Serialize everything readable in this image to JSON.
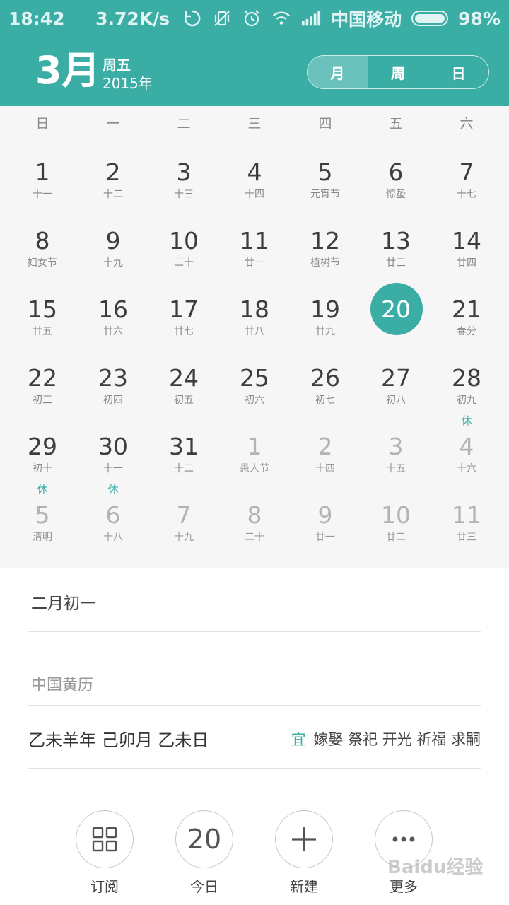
{
  "status_bar": {
    "time": "18:42",
    "speed": "3.72K/s",
    "carrier": "中国移动",
    "battery": "98%",
    "icons": [
      "sync-icon",
      "mute-icon",
      "alarm-icon",
      "wifi-icon",
      "signal-icon",
      "battery-icon"
    ]
  },
  "header": {
    "month": "3月",
    "weekday": "周五",
    "year": "2015年",
    "view_tabs": [
      "月",
      "周",
      "日"
    ],
    "active_tab": "月",
    "accent_color": "#3aada5"
  },
  "calendar": {
    "weekdays": [
      "日",
      "一",
      "二",
      "三",
      "四",
      "五",
      "六"
    ],
    "selected_day": "20",
    "weeks": [
      [
        {
          "day": "1",
          "lunar": "十一",
          "rest": ""
        },
        {
          "day": "2",
          "lunar": "十二",
          "rest": ""
        },
        {
          "day": "3",
          "lunar": "十三",
          "rest": ""
        },
        {
          "day": "4",
          "lunar": "十四",
          "rest": ""
        },
        {
          "day": "5",
          "lunar": "元宵节",
          "rest": ""
        },
        {
          "day": "6",
          "lunar": "惊蛰",
          "rest": ""
        },
        {
          "day": "7",
          "lunar": "十七",
          "rest": ""
        }
      ],
      [
        {
          "day": "8",
          "lunar": "妇女节",
          "rest": ""
        },
        {
          "day": "9",
          "lunar": "十九",
          "rest": ""
        },
        {
          "day": "10",
          "lunar": "二十",
          "rest": ""
        },
        {
          "day": "11",
          "lunar": "廿一",
          "rest": ""
        },
        {
          "day": "12",
          "lunar": "植树节",
          "rest": ""
        },
        {
          "day": "13",
          "lunar": "廿三",
          "rest": ""
        },
        {
          "day": "14",
          "lunar": "廿四",
          "rest": ""
        }
      ],
      [
        {
          "day": "15",
          "lunar": "廿五",
          "rest": ""
        },
        {
          "day": "16",
          "lunar": "廿六",
          "rest": ""
        },
        {
          "day": "17",
          "lunar": "廿七",
          "rest": ""
        },
        {
          "day": "18",
          "lunar": "廿八",
          "rest": ""
        },
        {
          "day": "19",
          "lunar": "廿九",
          "rest": ""
        },
        {
          "day": "20",
          "lunar": "",
          "rest": "",
          "today": true
        },
        {
          "day": "21",
          "lunar": "春分",
          "rest": ""
        }
      ],
      [
        {
          "day": "22",
          "lunar": "初三",
          "rest": ""
        },
        {
          "day": "23",
          "lunar": "初四",
          "rest": ""
        },
        {
          "day": "24",
          "lunar": "初五",
          "rest": ""
        },
        {
          "day": "25",
          "lunar": "初六",
          "rest": ""
        },
        {
          "day": "26",
          "lunar": "初七",
          "rest": ""
        },
        {
          "day": "27",
          "lunar": "初八",
          "rest": ""
        },
        {
          "day": "28",
          "lunar": "初九",
          "rest": ""
        }
      ],
      [
        {
          "day": "29",
          "lunar": "初十",
          "rest": ""
        },
        {
          "day": "30",
          "lunar": "十一",
          "rest": ""
        },
        {
          "day": "31",
          "lunar": "十二",
          "rest": ""
        },
        {
          "day": "1",
          "lunar": "愚人节",
          "rest": "",
          "other": true
        },
        {
          "day": "2",
          "lunar": "十四",
          "rest": "",
          "other": true
        },
        {
          "day": "3",
          "lunar": "十五",
          "rest": "",
          "other": true
        },
        {
          "day": "4",
          "lunar": "十六",
          "rest": "休",
          "other": true
        }
      ],
      [
        {
          "day": "5",
          "lunar": "清明",
          "rest": "休",
          "other": true
        },
        {
          "day": "6",
          "lunar": "十八",
          "rest": "休",
          "other": true
        },
        {
          "day": "7",
          "lunar": "十九",
          "rest": "",
          "other": true
        },
        {
          "day": "8",
          "lunar": "二十",
          "rest": "",
          "other": true
        },
        {
          "day": "9",
          "lunar": "廿一",
          "rest": "",
          "other": true
        },
        {
          "day": "10",
          "lunar": "廿二",
          "rest": "",
          "other": true
        },
        {
          "day": "11",
          "lunar": "廿三",
          "rest": "",
          "other": true
        }
      ]
    ]
  },
  "details": {
    "lunar_date": "二月初一",
    "almanac_title": "中国黄历",
    "ganzhi": "乙未羊年 己卯月 乙未日",
    "yi_label": "宜",
    "yi_items": "嫁娶 祭祀 开光 祈福 求嗣"
  },
  "actions": {
    "subscribe_label": "订阅",
    "today_label": "今日",
    "today_number": "20",
    "new_label": "新建",
    "more_label": "更多"
  },
  "watermark": "Baidu经验"
}
